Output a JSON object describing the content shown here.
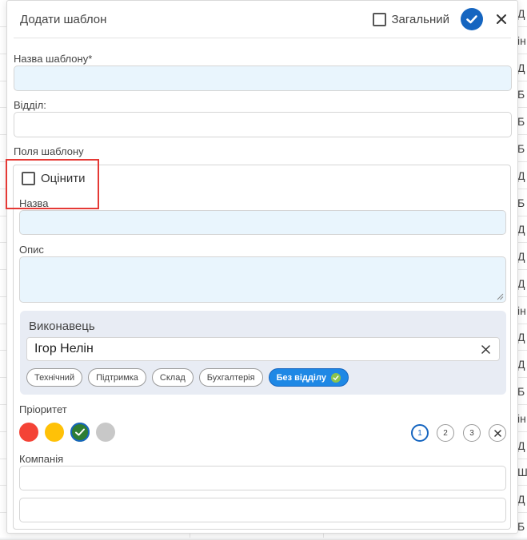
{
  "background_table": {
    "row_edge_texts": [
      "Д",
      "ін",
      "Д",
      "Б",
      "Б",
      "Б",
      "Д",
      "Б",
      "Д",
      "Д",
      "Д",
      "ін",
      "Д",
      "Д",
      "Б",
      "ін",
      "Д",
      "Ш",
      "Д",
      "Б"
    ]
  },
  "modal": {
    "title": "Додати шаблон",
    "general_checkbox_label": "Загальний",
    "general_checked": false,
    "confirm_icon": "check-icon",
    "close_icon": "close-icon"
  },
  "form": {
    "template_name_label": "Назва шаблону*",
    "template_name_value": "",
    "department_label": "Відділ:",
    "department_value": "",
    "template_fields_label": "Поля шаблону"
  },
  "template_fields": {
    "evaluate_label": "Оцінити",
    "evaluate_checked": false,
    "name_label": "Назва",
    "name_value": "",
    "description_label": "Опис",
    "description_value": "",
    "assignee": {
      "title": "Виконавець",
      "value": "Ігор Нелін",
      "departments": [
        {
          "label": "Технічний",
          "active": false
        },
        {
          "label": "Підтримка",
          "active": false
        },
        {
          "label": "Склад",
          "active": false
        },
        {
          "label": "Бухгалтерія",
          "active": false
        },
        {
          "label": "Без відділу",
          "active": true
        }
      ]
    },
    "priority": {
      "label": "Пріоритет",
      "colors": [
        {
          "name": "red",
          "color": "#f44336",
          "selected": false
        },
        {
          "name": "yellow",
          "color": "#ffc107",
          "selected": false
        },
        {
          "name": "green",
          "color": "#2e7d32",
          "selected": true
        },
        {
          "name": "gray",
          "color": "#c8c8c8",
          "selected": false
        }
      ],
      "levels": [
        "1",
        "2",
        "3"
      ],
      "selected_level": "1"
    },
    "company_label": "Компанія",
    "company_value": "",
    "extra_value": ""
  },
  "colors": {
    "accent": "#1565c0",
    "highlight": "#e53935",
    "input_tint": "#e9f5fd",
    "panel_bg": "#e8ecf4"
  }
}
